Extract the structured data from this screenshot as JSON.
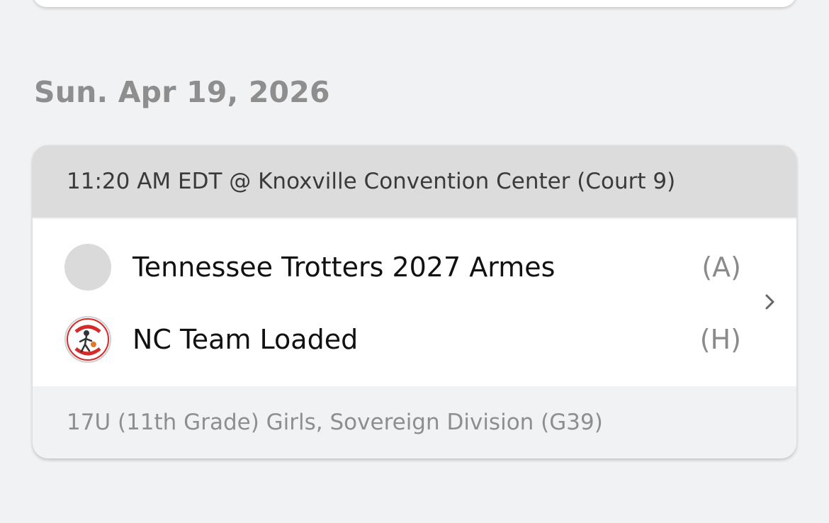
{
  "schedule": {
    "date_heading": "Sun. Apr 19, 2026",
    "game": {
      "time_location": "11:20 AM EDT @ Knoxville Convention Center (Court 9)",
      "away_team": {
        "name": "Tennessee Trotters 2027 Armes",
        "side": "(A)"
      },
      "home_team": {
        "name": "NC Team Loaded",
        "side": "(H)"
      },
      "division": "17U (11th Grade) Girls, Sovereign Division (G39)"
    }
  },
  "colors": {
    "background": "#f1f2f4",
    "header_bar": "#dcdcdc",
    "logo_red": "#d42a2a"
  },
  "icons": {
    "away_logo": "team-logo-placeholder-icon",
    "home_logo": "team-loaded-logo-icon",
    "chevron": "chevron-right-icon"
  }
}
